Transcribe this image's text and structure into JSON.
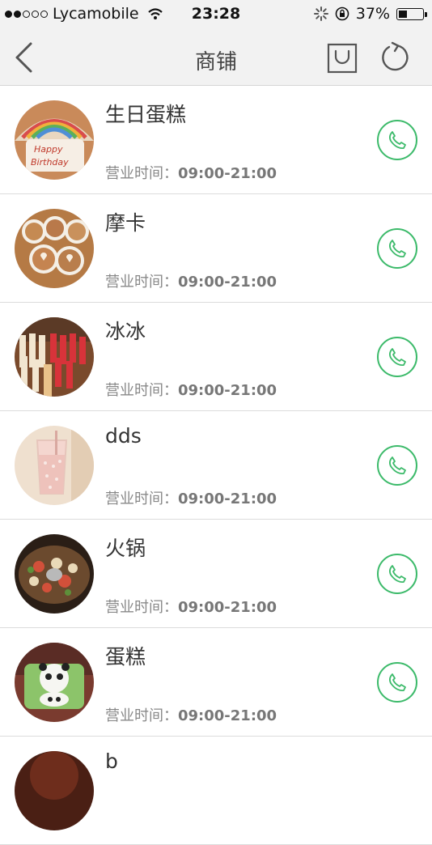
{
  "status_bar": {
    "carrier": "Lycamobile",
    "time": "23:28",
    "battery": "37%",
    "battery_level": 0.37
  },
  "nav": {
    "title": "商铺"
  },
  "colors": {
    "accent": "#3cba6a",
    "background": "#f2f2f2"
  },
  "shops": [
    {
      "name": "生日蛋糕",
      "hours_label": "营业时间：",
      "hours": "09:00-21:00"
    },
    {
      "name": "摩卡",
      "hours_label": "营业时间：",
      "hours": "09:00-21:00"
    },
    {
      "name": "冰冰",
      "hours_label": "营业时间：",
      "hours": "09:00-21:00"
    },
    {
      "name": "dds",
      "hours_label": "营业时间：",
      "hours": "09:00-21:00"
    },
    {
      "name": "火锅",
      "hours_label": "营业时间：",
      "hours": "09:00-21:00"
    },
    {
      "name": "蛋糕",
      "hours_label": "营业时间：",
      "hours": "09:00-21:00"
    },
    {
      "name": "b",
      "hours_label": "",
      "hours": ""
    }
  ]
}
